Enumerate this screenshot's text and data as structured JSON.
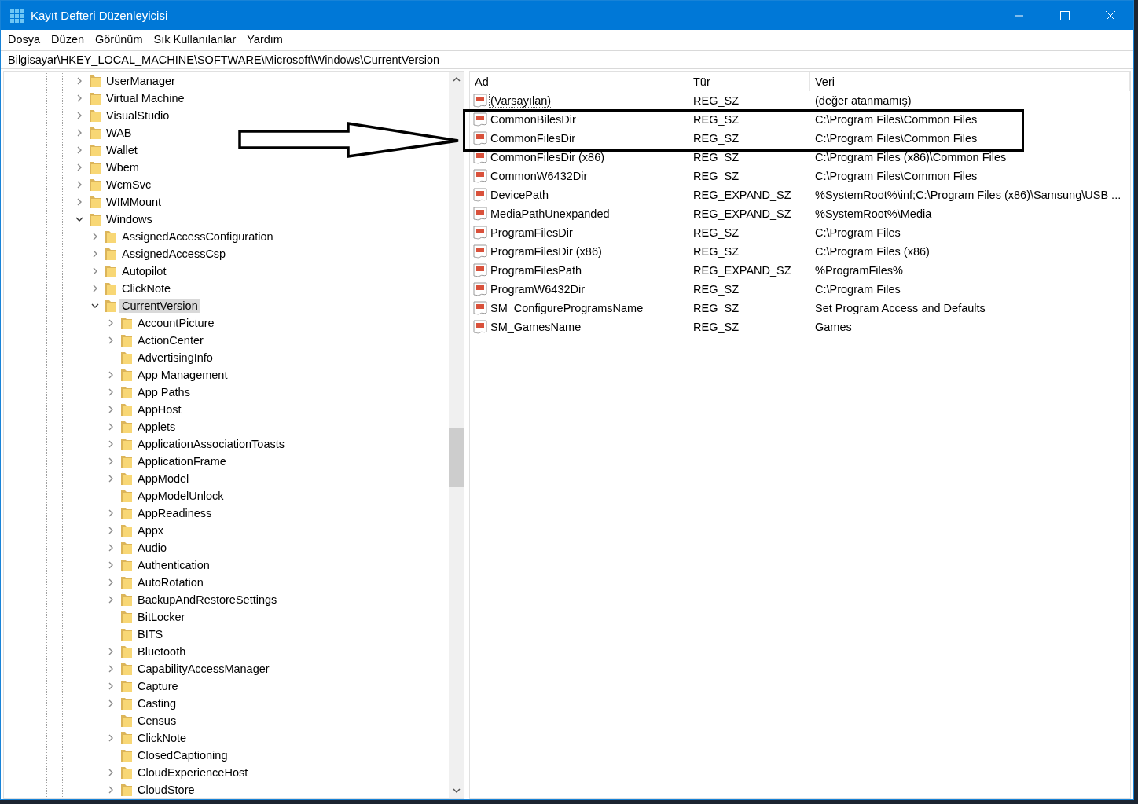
{
  "window": {
    "title": "Kayıt Defteri Düzenleyicisi"
  },
  "menu": [
    "Dosya",
    "Düzen",
    "Görünüm",
    "Sık Kullanılanlar",
    "Yardım"
  ],
  "address": "Bilgisayar\\HKEY_LOCAL_MACHINE\\SOFTWARE\\Microsoft\\Windows\\CurrentVersion",
  "tree": [
    {
      "label": "UserManager",
      "has_children": true,
      "expanded": false,
      "selected": false
    },
    {
      "label": "Virtual Machine",
      "has_children": true,
      "expanded": false,
      "selected": false
    },
    {
      "label": "VisualStudio",
      "has_children": true,
      "expanded": false,
      "selected": false
    },
    {
      "label": "WAB",
      "has_children": true,
      "expanded": false,
      "selected": false
    },
    {
      "label": "Wallet",
      "has_children": true,
      "expanded": false,
      "selected": false
    },
    {
      "label": "Wbem",
      "has_children": true,
      "expanded": false,
      "selected": false
    },
    {
      "label": "WcmSvc",
      "has_children": true,
      "expanded": false,
      "selected": false
    },
    {
      "label": "WIMMount",
      "has_children": true,
      "expanded": false,
      "selected": false
    },
    {
      "label": "Windows",
      "has_children": true,
      "expanded": true,
      "selected": false,
      "children": [
        {
          "label": "AssignedAccessConfiguration",
          "has_children": true,
          "expanded": false,
          "selected": false
        },
        {
          "label": "AssignedAccessCsp",
          "has_children": true,
          "expanded": false,
          "selected": false
        },
        {
          "label": "Autopilot",
          "has_children": true,
          "expanded": false,
          "selected": false
        },
        {
          "label": "ClickNote",
          "has_children": true,
          "expanded": false,
          "selected": false
        },
        {
          "label": "CurrentVersion",
          "has_children": true,
          "expanded": true,
          "selected": true,
          "children": [
            {
              "label": "AccountPicture",
              "has_children": true,
              "expanded": false,
              "selected": false
            },
            {
              "label": "ActionCenter",
              "has_children": true,
              "expanded": false,
              "selected": false
            },
            {
              "label": "AdvertisingInfo",
              "has_children": false,
              "expanded": false,
              "selected": false
            },
            {
              "label": "App Management",
              "has_children": true,
              "expanded": false,
              "selected": false
            },
            {
              "label": "App Paths",
              "has_children": true,
              "expanded": false,
              "selected": false
            },
            {
              "label": "AppHost",
              "has_children": true,
              "expanded": false,
              "selected": false
            },
            {
              "label": "Applets",
              "has_children": true,
              "expanded": false,
              "selected": false
            },
            {
              "label": "ApplicationAssociationToasts",
              "has_children": true,
              "expanded": false,
              "selected": false
            },
            {
              "label": "ApplicationFrame",
              "has_children": true,
              "expanded": false,
              "selected": false
            },
            {
              "label": "AppModel",
              "has_children": true,
              "expanded": false,
              "selected": false
            },
            {
              "label": "AppModelUnlock",
              "has_children": false,
              "expanded": false,
              "selected": false
            },
            {
              "label": "AppReadiness",
              "has_children": true,
              "expanded": false,
              "selected": false
            },
            {
              "label": "Appx",
              "has_children": true,
              "expanded": false,
              "selected": false
            },
            {
              "label": "Audio",
              "has_children": true,
              "expanded": false,
              "selected": false
            },
            {
              "label": "Authentication",
              "has_children": true,
              "expanded": false,
              "selected": false
            },
            {
              "label": "AutoRotation",
              "has_children": true,
              "expanded": false,
              "selected": false
            },
            {
              "label": "BackupAndRestoreSettings",
              "has_children": true,
              "expanded": false,
              "selected": false
            },
            {
              "label": "BitLocker",
              "has_children": false,
              "expanded": false,
              "selected": false
            },
            {
              "label": "BITS",
              "has_children": false,
              "expanded": false,
              "selected": false
            },
            {
              "label": "Bluetooth",
              "has_children": true,
              "expanded": false,
              "selected": false
            },
            {
              "label": "CapabilityAccessManager",
              "has_children": true,
              "expanded": false,
              "selected": false
            },
            {
              "label": "Capture",
              "has_children": true,
              "expanded": false,
              "selected": false
            },
            {
              "label": "Casting",
              "has_children": true,
              "expanded": false,
              "selected": false
            },
            {
              "label": "Census",
              "has_children": false,
              "expanded": false,
              "selected": false
            },
            {
              "label": "ClickNote",
              "has_children": true,
              "expanded": false,
              "selected": false
            },
            {
              "label": "ClosedCaptioning",
              "has_children": false,
              "expanded": false,
              "selected": false
            },
            {
              "label": "CloudExperienceHost",
              "has_children": true,
              "expanded": false,
              "selected": false
            },
            {
              "label": "CloudStore",
              "has_children": true,
              "expanded": false,
              "selected": false
            }
          ]
        }
      ]
    }
  ],
  "table": {
    "columns": [
      "Ad",
      "Tür",
      "Veri"
    ],
    "rows": [
      {
        "name": "(Varsayılan)",
        "type": "REG_SZ",
        "data": "(değer atanmamış)",
        "focused": true
      },
      {
        "name": "CommonBilesDir",
        "type": "REG_SZ",
        "data": "C:\\Program Files\\Common Files",
        "focused": false
      },
      {
        "name": "CommonFilesDir",
        "type": "REG_SZ",
        "data": "C:\\Program Files\\Common Files",
        "focused": false
      },
      {
        "name": "CommonFilesDir (x86)",
        "type": "REG_SZ",
        "data": "C:\\Program Files (x86)\\Common Files",
        "focused": false
      },
      {
        "name": "CommonW6432Dir",
        "type": "REG_SZ",
        "data": "C:\\Program Files\\Common Files",
        "focused": false
      },
      {
        "name": "DevicePath",
        "type": "REG_EXPAND_SZ",
        "data": "%SystemRoot%\\inf;C:\\Program Files (x86)\\Samsung\\USB ...",
        "focused": false
      },
      {
        "name": "MediaPathUnexpanded",
        "type": "REG_EXPAND_SZ",
        "data": "%SystemRoot%\\Media",
        "focused": false
      },
      {
        "name": "ProgramFilesDir",
        "type": "REG_SZ",
        "data": "C:\\Program Files",
        "focused": false
      },
      {
        "name": "ProgramFilesDir (x86)",
        "type": "REG_SZ",
        "data": "C:\\Program Files (x86)",
        "focused": false
      },
      {
        "name": "ProgramFilesPath",
        "type": "REG_EXPAND_SZ",
        "data": "%ProgramFiles%",
        "focused": false
      },
      {
        "name": "ProgramW6432Dir",
        "type": "REG_SZ",
        "data": "C:\\Program Files",
        "focused": false
      },
      {
        "name": "SM_ConfigureProgramsName",
        "type": "REG_SZ",
        "data": "Set Program Access and Defaults",
        "focused": false
      },
      {
        "name": "SM_GamesName",
        "type": "REG_SZ",
        "data": "Games",
        "focused": false
      }
    ]
  }
}
